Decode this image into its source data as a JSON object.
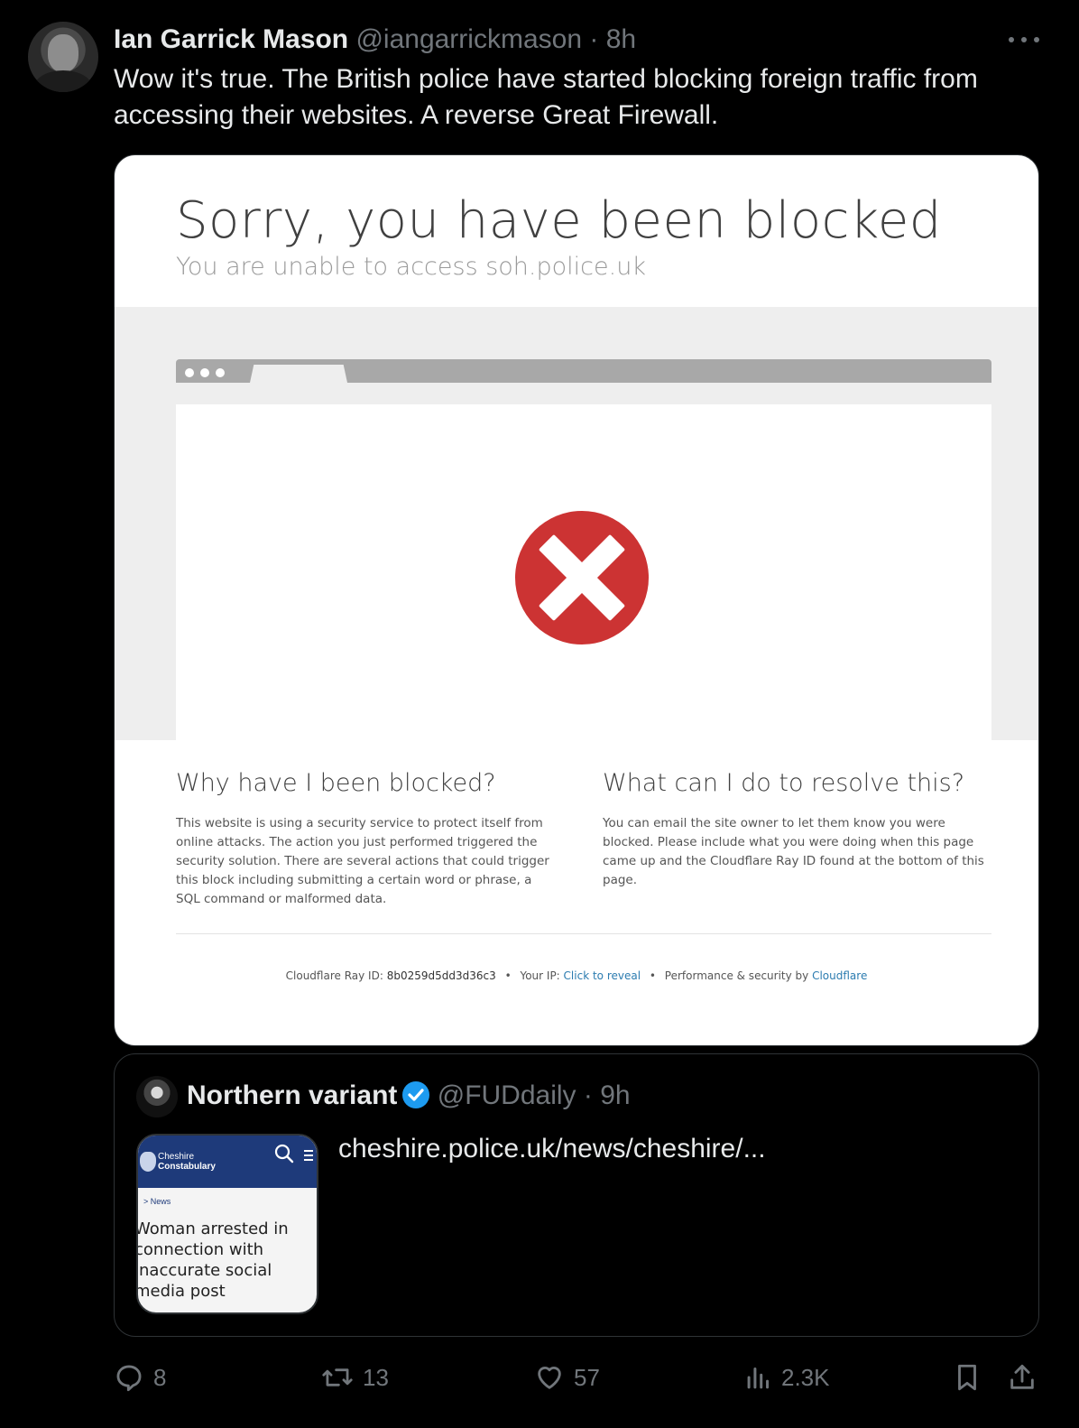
{
  "tweet": {
    "author_name": "Ian Garrick Mason",
    "author_handle": "@iangarrickmason",
    "separator": "·",
    "time": "8h",
    "text": "Wow it's true. The British police have started blocking foreign traffic from accessing their websites. A reverse Great Firewall."
  },
  "media": {
    "title": "Sorry, you have been blocked",
    "subtitle": "You are unable to access soh.police.uk",
    "left_heading": "Why have I been blocked?",
    "left_body": "This website is using a security service to protect itself from online attacks. The action you just performed triggered the security solution. There are several actions that could trigger this block including submitting a certain word or phrase, a SQL command or malformed data.",
    "right_heading": "What can I do to resolve this?",
    "right_body": "You can email the site owner to let them know you were blocked. Please include what you were doing when this page came up and the Cloudflare Ray ID found at the bottom of this page.",
    "footer": {
      "ray_label": "Cloudflare Ray ID:",
      "ray_id": "8b0259d5dd3d36c3",
      "bullet": "•",
      "ip_label": "Your IP:",
      "ip_link": "Click to reveal",
      "perf_label": "Performance & security by",
      "perf_link": "Cloudflare"
    }
  },
  "quote": {
    "author_name": "Northern variant",
    "author_handle": "@FUDdaily",
    "separator": "·",
    "time": "9h",
    "link_text": "cheshire.police.uk/news/cheshire/...",
    "thumb_brand_line1": "Cheshire",
    "thumb_brand_line2": "Constabulary",
    "thumb_crumb": "> News",
    "thumb_headline": "Woman arrested in connection with inaccurate social media post"
  },
  "actions": {
    "replies": "8",
    "reposts": "13",
    "likes": "57",
    "views": "2.3K"
  },
  "colors": {
    "background": "#000000",
    "text": "#e7e9ea",
    "muted": "#71767b",
    "border": "#2f3336",
    "verified": "#1d9bf0",
    "error_red": "#cc3333",
    "cloudflare_link": "#2c7cb0"
  }
}
